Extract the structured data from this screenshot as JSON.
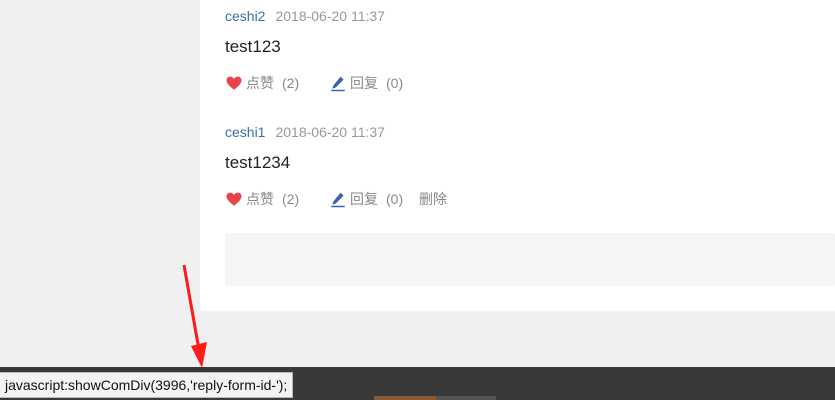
{
  "comments": [
    {
      "username": "ceshi2",
      "time": "2018-06-20 11:37",
      "text": "test123",
      "like_label": "点赞",
      "like_count": "(2)",
      "reply_label": "回复",
      "reply_count": "(0)"
    },
    {
      "username": "ceshi1",
      "time": "2018-06-20 11:37",
      "text": "test1234",
      "like_label": "点赞",
      "like_count": "(2)",
      "reply_label": "回复",
      "reply_count": "(0)",
      "delete_label": "删除"
    }
  ],
  "status_url": "javascript:showComDiv(3996,'reply-form-id-');",
  "colors": {
    "username": "#3c6fa8",
    "heart": "#e8424a",
    "pencil": "#3a62b0",
    "arrow": "#ff1a1a"
  },
  "icons": [
    "heart-icon",
    "pencil-icon",
    "annotation-arrow"
  ]
}
